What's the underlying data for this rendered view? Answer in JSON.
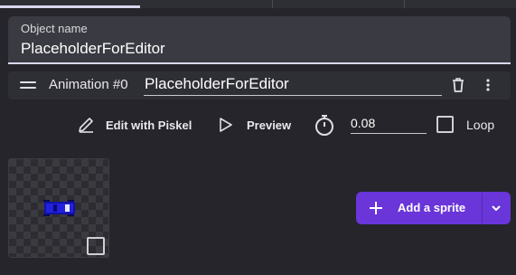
{
  "object_name": {
    "label": "Object name",
    "value": "PlaceholderForEditor"
  },
  "animation": {
    "label": "Animation #0",
    "name": "PlaceholderForEditor"
  },
  "toolbar": {
    "edit_label": "Edit with Piskel",
    "preview_label": "Preview",
    "fps_value": "0.08",
    "loop_label": "Loop",
    "loop_checked": false
  },
  "sprites": {
    "add_label": "Add a sprite"
  },
  "colors": {
    "accent": "#6a35d9",
    "background": "#25252b",
    "field": "#3a3a42"
  },
  "icons": [
    "drag-handle-icon",
    "trash-icon",
    "more-vertical-icon",
    "pencil-icon",
    "play-icon",
    "timer-icon",
    "plus-icon",
    "chevron-down-icon"
  ]
}
